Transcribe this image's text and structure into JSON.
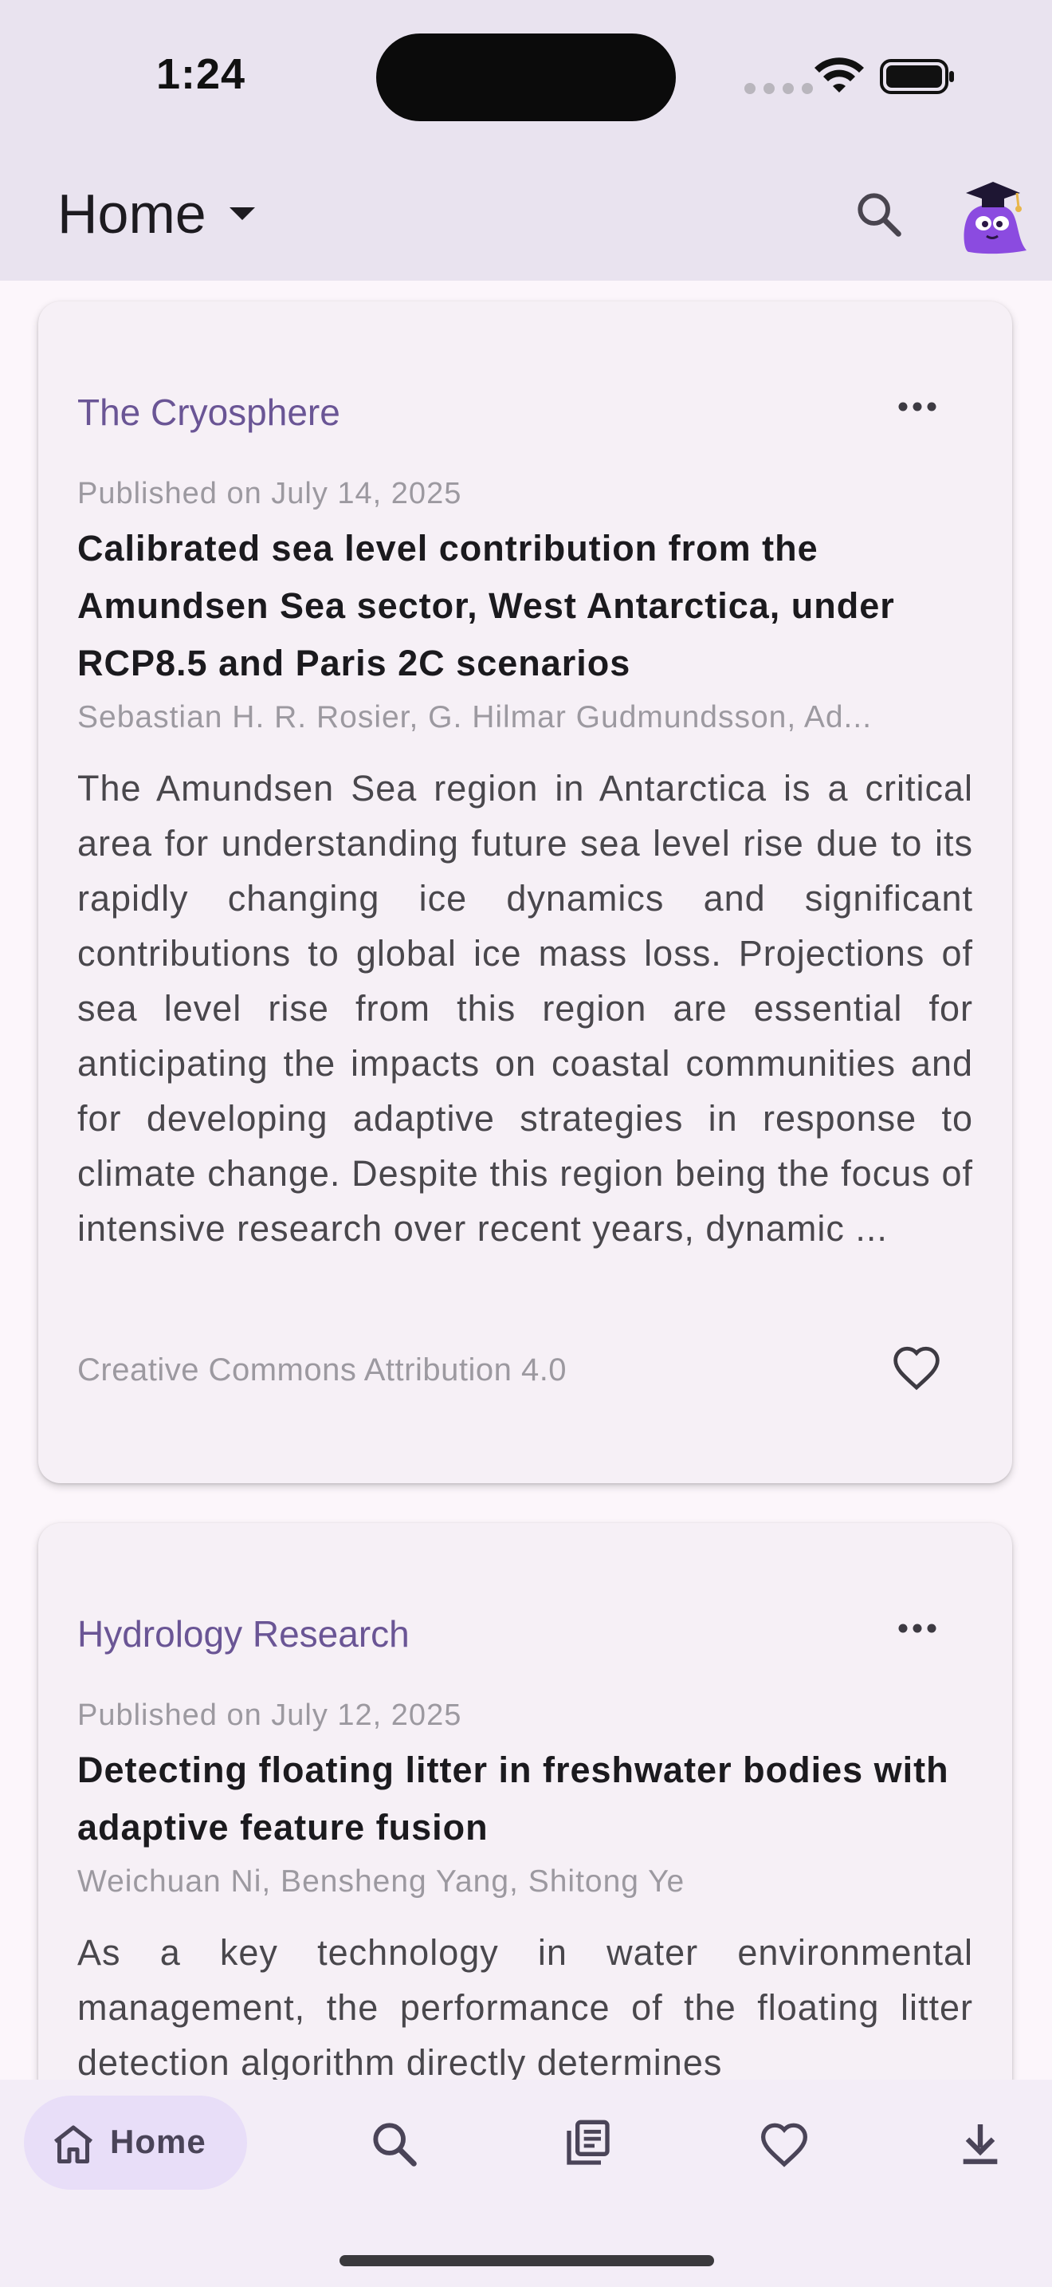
{
  "status_bar": {
    "time": "1:24"
  },
  "app_bar": {
    "title": "Home"
  },
  "articles": [
    {
      "journal": "The Cryosphere",
      "date": "Published on July 14, 2025",
      "title": "Calibrated sea level contribution from the Amundsen Sea sector, West Antarctica, under RCP8.5 and Paris 2C scenarios",
      "authors": "Sebastian H. R. Rosier, G. Hilmar Gudmundsson, Ad...",
      "abstract": "The Amundsen Sea region in Antarctica is a critical area for understanding future sea level rise due to its rapidly changing ice dynamics and significant contributions to global ice mass loss. Projections of sea level rise from this region are essential for anticipating the impacts on coastal communities and for developing adaptive strategies in response to climate change. Despite this region being the focus of intensive research over recent years, dynamic ...",
      "license": "Creative Commons Attribution 4.0"
    },
    {
      "journal": "Hydrology Research",
      "date": "Published on July 12, 2025",
      "title": "Detecting floating litter in freshwater bodies with adaptive feature fusion",
      "authors": "Weichuan Ni, Bensheng Yang, Shitong Ye",
      "abstract": "As a key technology in water environmental management, the performance of the floating litter detection algorithm directly determines"
    }
  ],
  "bottom_nav": {
    "items": [
      {
        "label": "Home",
        "icon": "home-icon",
        "active": true
      },
      {
        "icon": "search-icon"
      },
      {
        "icon": "library-icon"
      },
      {
        "icon": "favorite-icon"
      },
      {
        "icon": "download-icon"
      }
    ]
  },
  "colors": {
    "accent": "#6a5595",
    "appbar_bg": "#e9e3ef",
    "card_bg": "#f6f0f6",
    "nav_pill": "#e8def8"
  }
}
